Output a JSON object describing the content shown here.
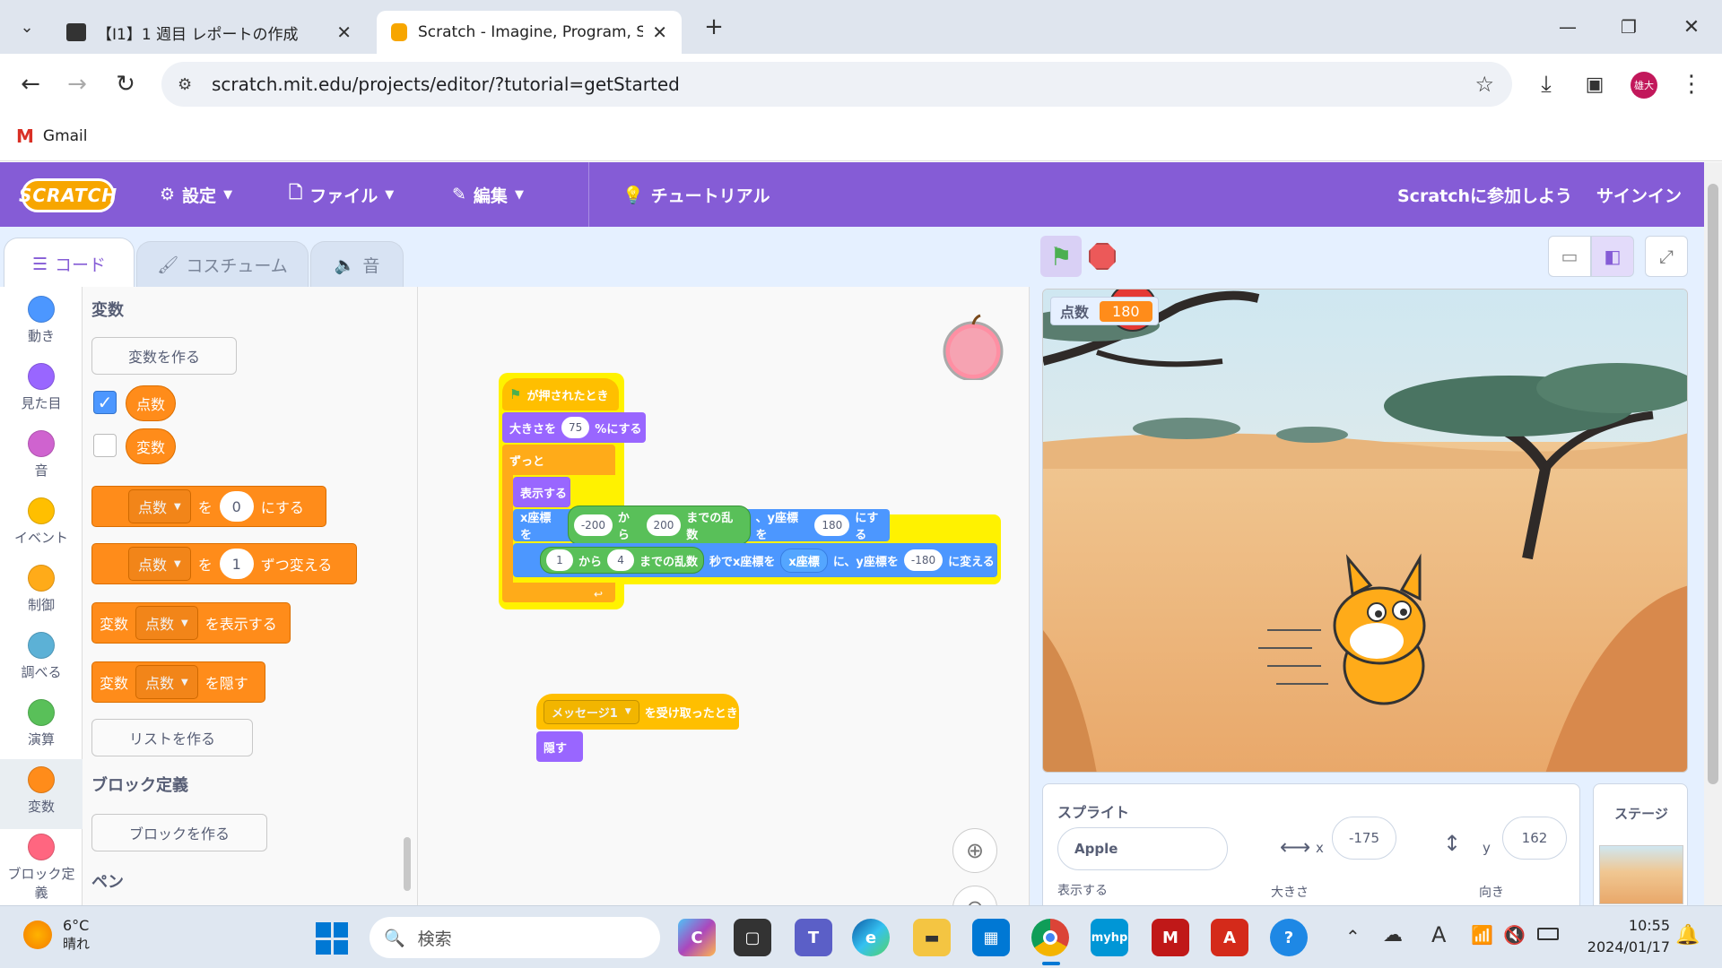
{
  "browser": {
    "tabs": [
      {
        "title": "【I1】1 週目 レポートの作成",
        "active": false
      },
      {
        "title": "Scratch - Imagine, Program, Sha",
        "active": true
      }
    ],
    "url": "scratch.mit.edu/projects/editor/?tutorial=getStarted",
    "bookmark": "Gmail",
    "profile": "雄大"
  },
  "scratch": {
    "logo": "SCRATCH",
    "menu": {
      "settings": "設定",
      "file": "ファイル",
      "edit": "編集",
      "tutorial": "チュートリアル",
      "join": "Scratchに参加しよう",
      "signin": "サインイン"
    },
    "editor_tabs": {
      "code": "コード",
      "costume": "コスチューム",
      "sound": "音"
    },
    "categories": [
      {
        "label": "動き",
        "color": "#4c97ff"
      },
      {
        "label": "見た目",
        "color": "#9966ff"
      },
      {
        "label": "音",
        "color": "#cf63cf"
      },
      {
        "label": "イベント",
        "color": "#ffbf00"
      },
      {
        "label": "制御",
        "color": "#ffab19"
      },
      {
        "label": "調べる",
        "color": "#5cb1d6"
      },
      {
        "label": "演算",
        "color": "#59c059"
      },
      {
        "label": "変数",
        "color": "#ff8c1a"
      },
      {
        "label": "ブロック定義",
        "color": "#ff6680"
      }
    ],
    "palette": {
      "section_vars": "変数",
      "make_var": "変数を作る",
      "vars": [
        {
          "name": "点数",
          "checked": true
        },
        {
          "name": "変数",
          "checked": false
        }
      ],
      "set_block": {
        "var": "点数",
        "a": "を",
        "val": "0",
        "b": "にする"
      },
      "change_block": {
        "var": "点数",
        "a": "を",
        "val": "1",
        "b": "ずつ変える"
      },
      "show_block": {
        "pre": "変数",
        "var": "点数",
        "post": "を表示する"
      },
      "hide_block": {
        "pre": "変数",
        "var": "点数",
        "post": "を隠す"
      },
      "make_list": "リストを作る",
      "section_myblocks": "ブロック定義",
      "make_block": "ブロックを作る",
      "section_pen": "ペン"
    },
    "script1": {
      "hat": "が押されたとき",
      "size_pre": "大きさを",
      "size_val": "75",
      "size_post": "%にする",
      "forever": "ずっと",
      "show": "表示する",
      "goto_pre": "x座標を",
      "rand1_from": "-200",
      "rand_kara": "から",
      "rand1_to": "200",
      "rand_made": "までの乱数",
      "goto_mid": "、y座標を",
      "goto_y": "180",
      "goto_post": "にする",
      "glide_from": "1",
      "glide_to": "4",
      "glide_mid": "秒でx座標を",
      "glide_xpos": "x座標",
      "glide_mid2": "に、y座標を",
      "glide_y": "-180",
      "glide_post": "に変える"
    },
    "script2": {
      "msg": "メッセージ1",
      "hat_post": "を受け取ったとき",
      "hide": "隠す"
    },
    "stage": {
      "monitor_label": "点数",
      "monitor_value": "180"
    },
    "sprite_info": {
      "sprite_label": "スプライト",
      "name": "Apple",
      "x_label": "x",
      "x": "-175",
      "y_label": "y",
      "y": "162",
      "show_label": "表示する",
      "size_label": "大きさ",
      "dir_label": "向き",
      "stage_label": "ステージ"
    }
  },
  "taskbar": {
    "weather_temp": "6°C",
    "weather_desc": "晴れ",
    "search": "検索",
    "time": "10:55",
    "date": "2024/01/17"
  }
}
